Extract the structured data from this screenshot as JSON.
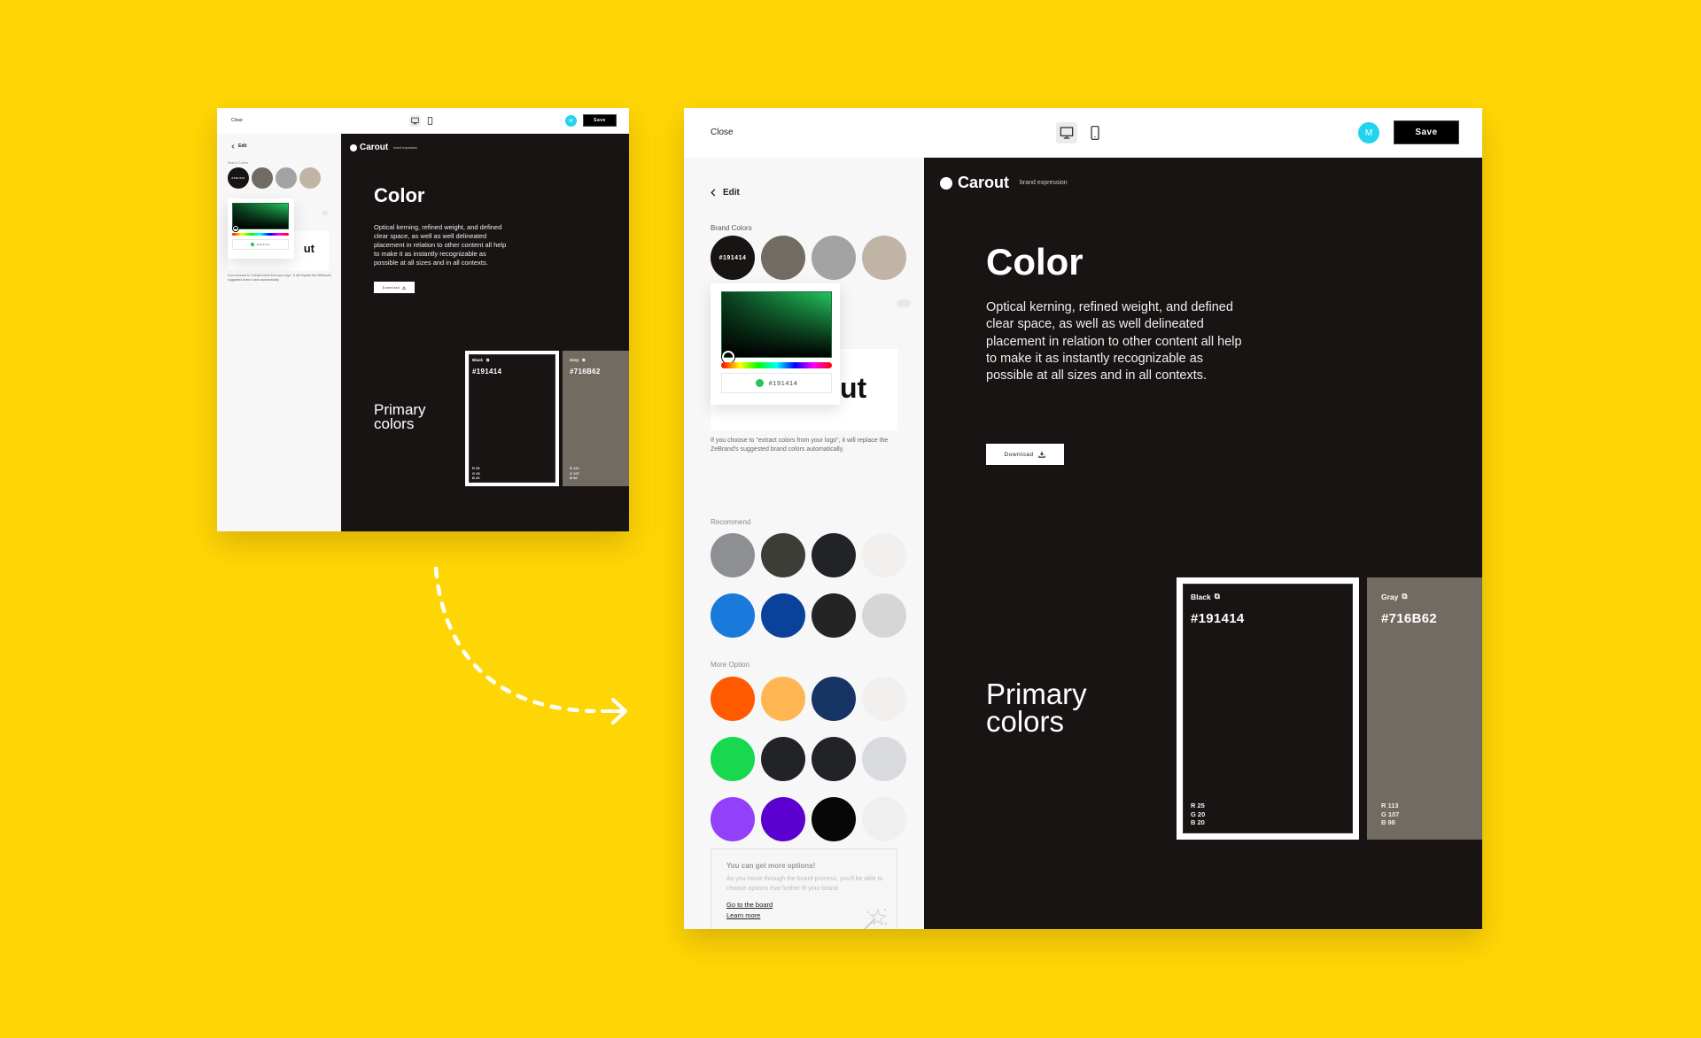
{
  "editor": {
    "header": {
      "close_label": "Close",
      "device_toggle": [
        {
          "name": "desktop",
          "icon": "desktop-icon",
          "active": true
        },
        {
          "name": "mobile",
          "icon": "mobile-icon",
          "active": false
        }
      ],
      "avatar_initial": "M",
      "avatar_color": "#22D3EE",
      "save_label": "Save"
    },
    "sidebar": {
      "back_label": "Edit",
      "brand_colors_label": "Brand Colors",
      "brand_colors": [
        {
          "hex": "#191414",
          "label": "#191414",
          "selected": true
        },
        {
          "hex": "#716B62"
        },
        {
          "hex": "#A3A3A3"
        },
        {
          "hex": "#C0B4A4"
        }
      ],
      "picker": {
        "hex_value": "#191414",
        "preview_color": "#22C55E"
      },
      "extract_toggle_on": false,
      "logo_fragment": "ut",
      "note": "If you choose to \"extract colors from your logo\", it will replace the ZeBrand's suggested brand colors automatically.",
      "recommend_label": "Recommend",
      "recommend_colors": [
        [
          "#8E8F92",
          "#3D3D38",
          "#222326",
          "#F1F0EE"
        ],
        [
          "#1A7ADB",
          "#0A419A",
          "#242424",
          "#D6D6D6"
        ]
      ],
      "more_option_label": "More Option",
      "more_option_colors": [
        [
          "#FF5A00",
          "#FFB652",
          "#163564",
          "#F1F0EE"
        ],
        [
          "#17D84E",
          "#222326",
          "#222326",
          "#D9DADE"
        ],
        [
          "#9340FA",
          "#5C00CF",
          "#070707",
          "#EFEFEF"
        ]
      ],
      "info_box": {
        "title": "You can get more options!",
        "description": "As you move through the board process, you'll be able to choose options that further fit your brand.",
        "links": [
          "Go to the board",
          "Learn more"
        ]
      }
    },
    "stage": {
      "brand_name": "Carout",
      "brand_tagline": "brand expression",
      "heading": "Color",
      "paragraph": "Optical kerning, refined weight, and defined clear space, as well as well delineated placement in relation to other content all help to make it as instantly recognizable as possible at all sizes and in all contexts.",
      "download_label": "Download",
      "primary_label_line1": "Primary",
      "primary_label_line2": "colors",
      "primary_colors": [
        {
          "name": "Black",
          "hex": "#191414",
          "r": "R 25",
          "g": "G 20",
          "b": "B 20",
          "selected": true
        },
        {
          "name": "Gray",
          "hex": "#716B62",
          "r": "R 113",
          "g": "G 107",
          "b": "B 98",
          "selected": false
        }
      ]
    }
  },
  "preview_small": {
    "gray_card_name": "Grey"
  },
  "theme": {
    "background": "#FFD605",
    "stage_bg": "#191414",
    "sidebar_bg": "#F7F7F7"
  }
}
